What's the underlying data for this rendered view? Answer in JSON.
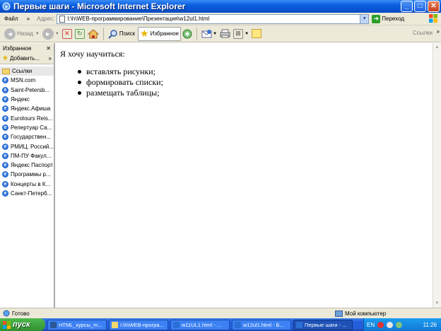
{
  "window": {
    "title": "Первые шаги - Microsoft Internet Explorer",
    "buttons": [
      "minimize",
      "maximize",
      "close"
    ]
  },
  "menu": {
    "file_label": "Файл",
    "more_label": "»"
  },
  "address": {
    "label": "Адрес:",
    "value": "I:\\h\\WEB-программирование\\Презентация\\w12ul1.html",
    "go_label": "Переход"
  },
  "toolbar": {
    "back_label": "Назад",
    "search_label": "Поиск",
    "favorites_label": "Избранное",
    "links_label": "Ссылки"
  },
  "favorites": {
    "header": "Избранное",
    "add_label": "Добавить...",
    "items": [
      {
        "label": "Ссылки",
        "type": "folder"
      },
      {
        "label": "MSN.com",
        "type": "link"
      },
      {
        "label": "Saint-Petersb...",
        "type": "link"
      },
      {
        "label": "Яндекс",
        "type": "link"
      },
      {
        "label": "Яндекс.Афиша",
        "type": "link"
      },
      {
        "label": "Eurotours Reis...",
        "type": "link"
      },
      {
        "label": "Репертуар Са...",
        "type": "link"
      },
      {
        "label": "Государствен...",
        "type": "link"
      },
      {
        "label": "РМИЦ. Россий...",
        "type": "link"
      },
      {
        "label": "ПМ-ПУ Факул...",
        "type": "link"
      },
      {
        "label": "Яндекс Паспорт",
        "type": "link"
      },
      {
        "label": "Программы р...",
        "type": "link"
      },
      {
        "label": "Концерты в К...",
        "type": "link"
      },
      {
        "label": "Санкт-Петерб...",
        "type": "link"
      }
    ]
  },
  "content": {
    "intro": "Я хочу научиться:",
    "items": [
      "вставлять рисунки;",
      "формировать списки;",
      "размещать таблицы;"
    ]
  },
  "status": {
    "text": "Готово",
    "zone": "Мой компьютер"
  },
  "taskbar": {
    "start_label": "пуск",
    "tasks": [
      {
        "label": "HTML_курсы_m...",
        "active": false,
        "color": "#2b5797"
      },
      {
        "label": "I:\\h\\WEB-програ...",
        "active": false,
        "color": "#f5d66c"
      },
      {
        "label": "w11UL1.html - ...",
        "active": false,
        "color": "#2a6fd6"
      },
      {
        "label": "w12ul1.html - Б...",
        "active": false,
        "color": "#2a6fd6"
      },
      {
        "label": "Первые шаги - ...",
        "active": true,
        "color": "#2a6fd6"
      }
    ],
    "lang": "EN",
    "clock": "11:26"
  }
}
